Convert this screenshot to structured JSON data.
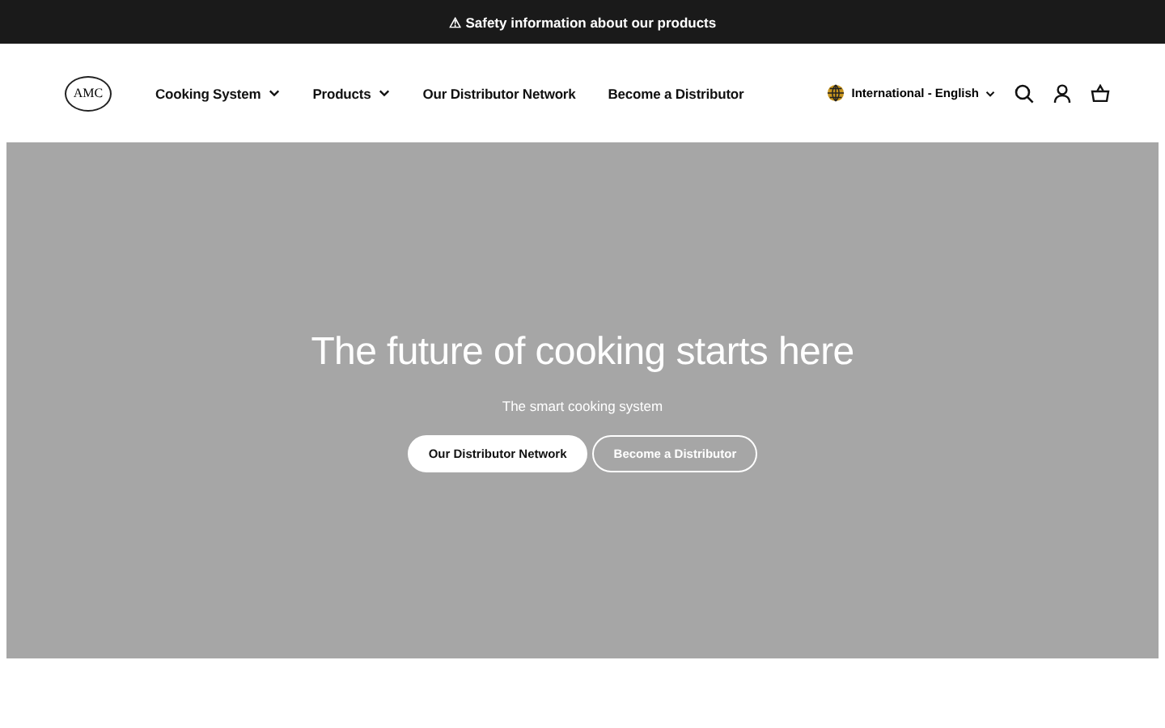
{
  "announcement": {
    "icon": "⚠",
    "text": "Safety information about our products"
  },
  "header": {
    "logo": "AMC",
    "nav": [
      {
        "label": "Cooking System",
        "has_dropdown": true
      },
      {
        "label": "Products",
        "has_dropdown": true
      },
      {
        "label": "Our Distributor Network",
        "has_dropdown": false
      },
      {
        "label": "Become a Distributor",
        "has_dropdown": false
      }
    ],
    "locale": "International - English"
  },
  "hero": {
    "title": "The future of cooking starts here",
    "subtitle": "The smart cooking system",
    "buttons": [
      {
        "label": "Our Distributor Network",
        "kind": "primary"
      },
      {
        "label": "Become a Distributor",
        "kind": "outline"
      }
    ]
  }
}
